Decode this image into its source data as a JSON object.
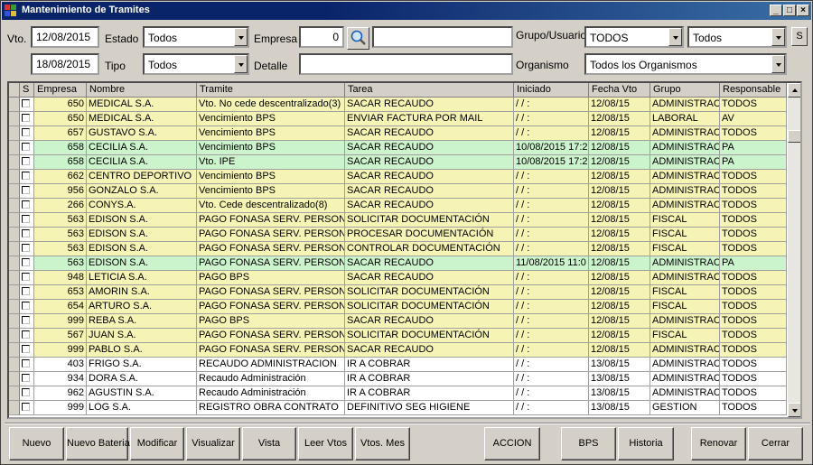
{
  "window": {
    "title": "Mantenimiento de Tramites"
  },
  "filters": {
    "vto_label": "Vto.",
    "vto_from": "12/08/2015",
    "vto_to": "18/08/2015",
    "estado_label": "Estado",
    "estado_value": "Todos",
    "tipo_label": "Tipo",
    "tipo_value": "Todos",
    "empresa_label": "Empresa",
    "empresa_value": "0",
    "empresa_name": "",
    "detalle_label": "Detalle",
    "detalle_value": "",
    "grupo_label": "Grupo/Usuario",
    "grupo_value": "TODOS",
    "usuario_value": "Todos",
    "organismo_label": "Organismo",
    "organismo_value": "Todos los Organismos",
    "s_button": "S"
  },
  "grid": {
    "columns": [
      "S",
      "Empresa",
      "Nombre",
      "Tramite",
      "Tarea",
      "Iniciado",
      "Fecha Vto",
      "Grupo",
      "Responsable"
    ],
    "rows": [
      {
        "empresa": "650",
        "nombre": "MEDICAL S.A.",
        "tramite": "Vto. No cede descentralizado(3)",
        "tarea": "SACAR RECAUDO",
        "iniciado": " / /    :",
        "vto": "12/08/15",
        "grupo": "ADMINISTRACI",
        "resp": "TODOS",
        "color": "#f6f4b4"
      },
      {
        "empresa": "650",
        "nombre": "MEDICAL S.A.",
        "tramite": "Vencimiento BPS",
        "tarea": "ENVIAR FACTURA POR MAIL",
        "iniciado": " / /    :",
        "vto": "12/08/15",
        "grupo": "LABORAL",
        "resp": "AV",
        "color": "#f6f4b4"
      },
      {
        "empresa": "657",
        "nombre": "GUSTAVO S.A.",
        "tramite": "Vencimiento BPS",
        "tarea": "SACAR RECAUDO",
        "iniciado": " / /    :",
        "vto": "12/08/15",
        "grupo": "ADMINISTRACI",
        "resp": "TODOS",
        "color": "#f6f4b4"
      },
      {
        "empresa": "658",
        "nombre": "CECILIA  S.A.",
        "tramite": "Vencimiento BPS",
        "tarea": "SACAR RECAUDO",
        "iniciado": "10/08/2015 17:2",
        "vto": "12/08/15",
        "grupo": "ADMINISTRACI",
        "resp": "PA",
        "color": "#ccf4cc"
      },
      {
        "empresa": "658",
        "nombre": "CECILIA  S.A.",
        "tramite": "Vto. IPE",
        "tarea": "SACAR RECAUDO",
        "iniciado": "10/08/2015 17:2",
        "vto": "12/08/15",
        "grupo": "ADMINISTRACI",
        "resp": "PA",
        "color": "#ccf4cc"
      },
      {
        "empresa": "662",
        "nombre": "CENTRO DEPORTIVO",
        "tramite": "Vencimiento BPS",
        "tarea": "SACAR RECAUDO",
        "iniciado": " / /    :",
        "vto": "12/08/15",
        "grupo": "ADMINISTRACI",
        "resp": "TODOS",
        "color": "#f6f4b4"
      },
      {
        "empresa": "956",
        "nombre": "GONZALO S.A.",
        "tramite": "Vencimiento BPS",
        "tarea": "SACAR RECAUDO",
        "iniciado": " / /    :",
        "vto": "12/08/15",
        "grupo": "ADMINISTRACI",
        "resp": "TODOS",
        "color": "#f6f4b4"
      },
      {
        "empresa": "266",
        "nombre": "CONYS.A.",
        "tramite": "Vto. Cede descentralizado(8)",
        "tarea": "SACAR RECAUDO",
        "iniciado": " / /    :",
        "vto": "12/08/15",
        "grupo": "ADMINISTRACI",
        "resp": "TODOS",
        "color": "#f6f4b4"
      },
      {
        "empresa": "563",
        "nombre": "EDISON S.A.",
        "tramite": "PAGO FONASA SERV. PERSONA",
        "tarea": "SOLICITAR DOCUMENTACIÓN",
        "iniciado": " / /    :",
        "vto": "12/08/15",
        "grupo": "FISCAL",
        "resp": "TODOS",
        "color": "#f6f4b4"
      },
      {
        "empresa": "563",
        "nombre": "EDISON S.A.",
        "tramite": "PAGO FONASA SERV. PERSONA",
        "tarea": "PROCESAR DOCUMENTACIÓN",
        "iniciado": " / /    :",
        "vto": "12/08/15",
        "grupo": "FISCAL",
        "resp": "TODOS",
        "color": "#f6f4b4"
      },
      {
        "empresa": "563",
        "nombre": "EDISON S.A.",
        "tramite": "PAGO FONASA SERV. PERSONA",
        "tarea": "CONTROLAR DOCUMENTACIÓN",
        "iniciado": " / /    :",
        "vto": "12/08/15",
        "grupo": "FISCAL",
        "resp": "TODOS",
        "color": "#f6f4b4"
      },
      {
        "empresa": "563",
        "nombre": "EDISON S.A.",
        "tramite": "PAGO FONASA SERV. PERSONA",
        "tarea": "SACAR RECAUDO",
        "iniciado": "11/08/2015 11:0",
        "vto": "12/08/15",
        "grupo": "ADMINISTRACI",
        "resp": "PA",
        "color": "#ccf4cc"
      },
      {
        "empresa": "948",
        "nombre": "LETICIA S.A.",
        "tramite": "PAGO BPS",
        "tarea": "SACAR RECAUDO",
        "iniciado": " / /    :",
        "vto": "12/08/15",
        "grupo": "ADMINISTRACI",
        "resp": "TODOS",
        "color": "#f6f4b4"
      },
      {
        "empresa": "653",
        "nombre": "AMORIN S.A.",
        "tramite": "PAGO FONASA SERV. PERSONA",
        "tarea": "SOLICITAR DOCUMENTACIÓN",
        "iniciado": " / /    :",
        "vto": "12/08/15",
        "grupo": "FISCAL",
        "resp": "TODOS",
        "color": "#f6f4b4"
      },
      {
        "empresa": "654",
        "nombre": "ARTURO S.A.",
        "tramite": "PAGO FONASA SERV. PERSONA",
        "tarea": "SOLICITAR DOCUMENTACIÓN",
        "iniciado": " / /    :",
        "vto": "12/08/15",
        "grupo": "FISCAL",
        "resp": "TODOS",
        "color": "#f6f4b4"
      },
      {
        "empresa": "999",
        "nombre": "REBA S.A.",
        "tramite": "PAGO BPS",
        "tarea": "SACAR RECAUDO",
        "iniciado": " / /    :",
        "vto": "12/08/15",
        "grupo": "ADMINISTRACI",
        "resp": "TODOS",
        "color": "#f6f4b4"
      },
      {
        "empresa": "567",
        "nombre": "JUAN S.A.",
        "tramite": "PAGO FONASA SERV. PERSONA",
        "tarea": "SOLICITAR DOCUMENTACIÓN",
        "iniciado": " / /    :",
        "vto": "12/08/15",
        "grupo": "FISCAL",
        "resp": "TODOS",
        "color": "#f6f4b4"
      },
      {
        "empresa": "999",
        "nombre": "PABLO S.A.",
        "tramite": "PAGO FONASA SERV. PERSONA",
        "tarea": "SACAR RECAUDO",
        "iniciado": " / /    :",
        "vto": "12/08/15",
        "grupo": "ADMINISTRACI",
        "resp": "TODOS",
        "color": "#f6f4b4"
      },
      {
        "empresa": "403",
        "nombre": "FRIGO S.A.",
        "tramite": "RECAUDO ADMINISTRACION",
        "tarea": "IR A COBRAR",
        "iniciado": " / /    :",
        "vto": "13/08/15",
        "grupo": "ADMINISTRACI",
        "resp": "TODOS",
        "color": "#ffffff"
      },
      {
        "empresa": "934",
        "nombre": "DORA S.A.",
        "tramite": "Recaudo Administración",
        "tarea": "IR A COBRAR",
        "iniciado": " / /    :",
        "vto": "13/08/15",
        "grupo": "ADMINISTRACI",
        "resp": "TODOS",
        "color": "#ffffff"
      },
      {
        "empresa": "962",
        "nombre": "AGUSTIN S.A.",
        "tramite": "Recaudo Administración",
        "tarea": "IR A COBRAR",
        "iniciado": " / /    :",
        "vto": "13/08/15",
        "grupo": "ADMINISTRACI",
        "resp": "TODOS",
        "color": "#ffffff"
      },
      {
        "empresa": "999",
        "nombre": "LOG S.A.",
        "tramite": "REGISTRO OBRA CONTRATO",
        "tarea": "DEFINITIVO SEG HIGIENE",
        "iniciado": " / /    :",
        "vto": "13/08/15",
        "grupo": "GESTION",
        "resp": "TODOS",
        "color": "#ffffff"
      }
    ]
  },
  "buttons": {
    "nuevo": "Nuevo",
    "nuevo_bateria": "Nuevo Bateria",
    "modificar": "Modificar",
    "visualizar": "Visualizar",
    "vista": "Vista",
    "leer_vtos": "Leer Vtos",
    "vtos_mes": "Vtos. Mes",
    "accion": "ACCION",
    "bps": "BPS",
    "historia": "Historia",
    "renovar": "Renovar",
    "cerrar": "Cerrar"
  },
  "colors": {
    "pending_row": "#f6f4b4",
    "started_row": "#ccf4cc",
    "future_row": "#ffffff",
    "titlebar": "#0a246a"
  }
}
